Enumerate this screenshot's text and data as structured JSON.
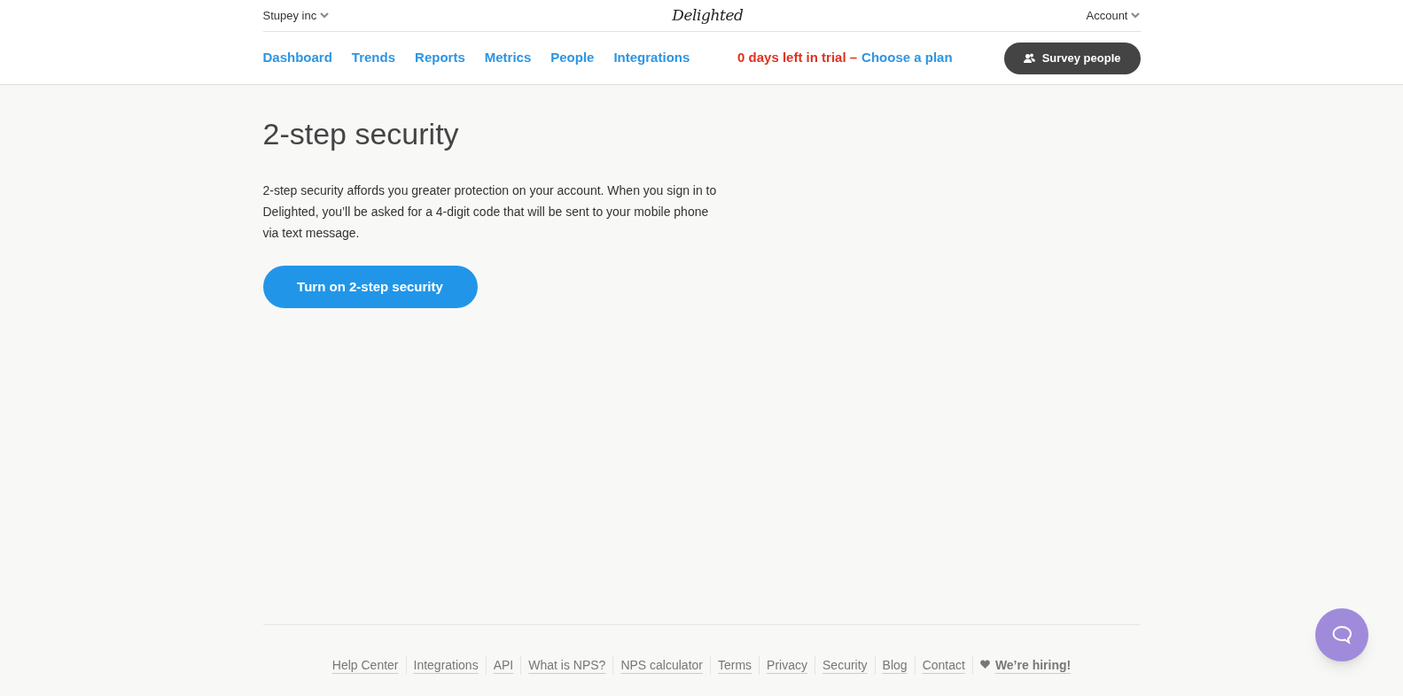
{
  "top_bar": {
    "org": "Stupey inc",
    "logo": "Delighted",
    "account": "Account"
  },
  "nav": {
    "items": [
      {
        "label": "Dashboard"
      },
      {
        "label": "Trends"
      },
      {
        "label": "Reports"
      },
      {
        "label": "Metrics"
      },
      {
        "label": "People"
      },
      {
        "label": "Integrations"
      }
    ],
    "trial_notice": "0 days left in trial –",
    "trial_link": "Choose a plan",
    "survey_button": "Survey people"
  },
  "main": {
    "title": "2-step security",
    "description": "2-step security affords you greater protection on your account. When you sign in to Delighted, you’ll be asked for a 4-digit code that will be sent to your mobile phone via text message.",
    "button": "Turn on 2-step security"
  },
  "footer": {
    "links": [
      {
        "label": "Help Center",
        "kind": "link"
      },
      {
        "label": "Integrations",
        "kind": "link"
      },
      {
        "label": "API",
        "kind": "link"
      },
      {
        "label": "What is NPS?",
        "kind": "link"
      },
      {
        "label": "NPS calculator",
        "kind": "link"
      },
      {
        "label": "Terms",
        "kind": "link"
      },
      {
        "label": "Privacy",
        "kind": "link"
      },
      {
        "label": "Security",
        "kind": "link"
      },
      {
        "label": "Blog",
        "kind": "link"
      },
      {
        "label": "Contact",
        "kind": "link"
      },
      {
        "label": "We’re hiring!",
        "kind": "hiring"
      }
    ]
  }
}
